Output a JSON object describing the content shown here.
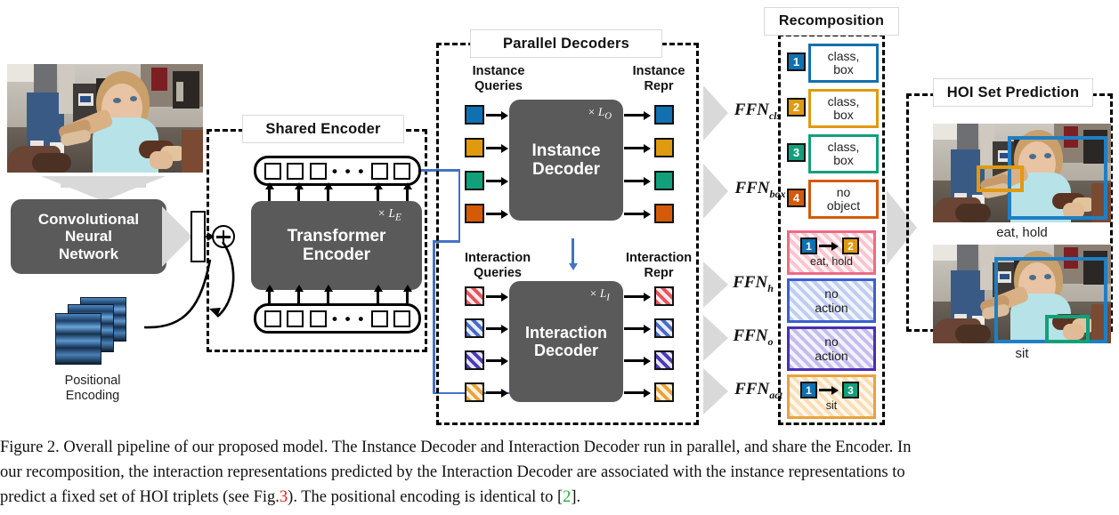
{
  "figure": {
    "caption_line1": "Figure 2. Overall pipeline of our proposed model. The Instance Decoder and Interaction Decoder run in parallel, and share the Encoder. In",
    "caption_line2": "our recomposition, the interaction representations predicted by the Interaction Decoder are associated with the instance representations to",
    "caption_line3_a": "predict a fixed set of HOI triplets (see Fig.",
    "caption_ref_fig": "3",
    "caption_line3_b": "). The positional encoding is identical to [",
    "caption_ref_cite": "2",
    "caption_line3_c": "]."
  },
  "backbone": {
    "cnn_label": "Convolutional\nNeural\nNetwork",
    "cnn_line1": "Convolutional",
    "cnn_line2": "Neural",
    "cnn_line3": "Network",
    "positional_encoding_line1": "Positional",
    "positional_encoding_line2": "Encoding"
  },
  "encoder": {
    "title": "Shared Encoder",
    "box_line1": "Transformer",
    "box_line2": "Encoder",
    "repeat": "× L",
    "repeat_sub": "E",
    "token_ellipsis": "• • •",
    "token_count_left": 3,
    "token_count_right": 2
  },
  "decoders": {
    "title": "Parallel Decoders",
    "instance": {
      "queries_line1": "Instance",
      "queries_line2": "Queries",
      "repr_line1": "Instance",
      "repr_line2": "Repr",
      "box_line1": "Instance",
      "box_line2": "Decoder",
      "repeat": "× L",
      "repeat_sub": "O",
      "query_colors": [
        "#1070b0",
        "#e09a10",
        "#12a07a",
        "#d45a0a"
      ]
    },
    "interaction": {
      "queries_line1": "Interaction",
      "queries_line2": "Queries",
      "repr_line1": "Interaction",
      "repr_line2": "Repr",
      "box_line1": "Interaction",
      "box_line2": "Decoder",
      "repeat": "× L",
      "repeat_sub": "I",
      "query_colors": [
        "#e8535b",
        "#4a69c8",
        "#4b3bb5",
        "#e8a33d"
      ]
    }
  },
  "ffn": [
    {
      "name": "FFN",
      "sub": "cls"
    },
    {
      "name": "FFN",
      "sub": "box"
    },
    {
      "name": "FFN",
      "sub": "h"
    },
    {
      "name": "FFN",
      "sub": "o"
    },
    {
      "name": "FFN",
      "sub": "act"
    }
  ],
  "recomposition": {
    "title": "Recomposition",
    "instance_cards": [
      {
        "index": "1",
        "color": "#1070b0",
        "line1": "class,",
        "line2": "box"
      },
      {
        "index": "2",
        "color": "#e09a10",
        "line1": "class,",
        "line2": "box"
      },
      {
        "index": "3",
        "color": "#12a07a",
        "line1": "class,",
        "line2": "box"
      },
      {
        "index": "4",
        "color": "#d45a0a",
        "line1": "no",
        "line2": "object"
      }
    ],
    "interaction_cards": [
      {
        "color": "#ee6b86",
        "type": "triplet",
        "subject": "1",
        "subject_color": "#1070b0",
        "object": "2",
        "object_color": "#e09a10",
        "label": "eat, hold"
      },
      {
        "color": "#3b5fd0",
        "type": "none",
        "line1": "no",
        "line2": "action"
      },
      {
        "color": "#4b2fb0",
        "type": "none",
        "line1": "no",
        "line2": "action"
      },
      {
        "color": "#e8a33d",
        "type": "triplet",
        "subject": "1",
        "subject_color": "#1070b0",
        "object": "3",
        "object_color": "#12a07a",
        "label": "sit"
      }
    ]
  },
  "prediction": {
    "title": "HOI Set Prediction",
    "items": [
      {
        "caption": "eat, hold",
        "boxes": [
          {
            "color": "#1f7fc4"
          },
          {
            "color": "#e09a10"
          }
        ]
      },
      {
        "caption": "sit",
        "boxes": [
          {
            "color": "#1f7fc4"
          },
          {
            "color": "#12a07a"
          }
        ]
      }
    ]
  }
}
